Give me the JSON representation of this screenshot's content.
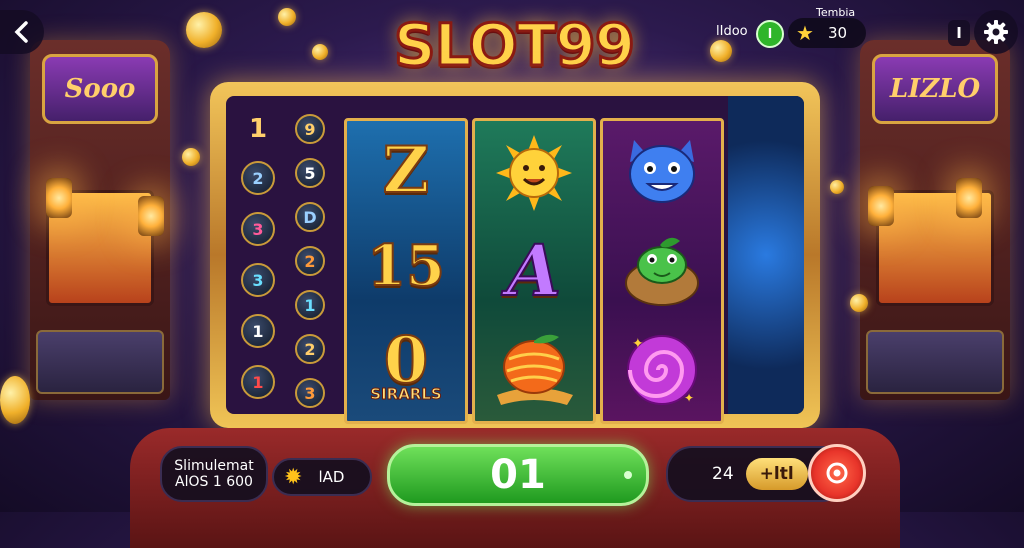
{
  "topbar": {
    "back_icon": "chevron-left-icon",
    "title": "SLOT99",
    "level_label": "lIdoo",
    "level_badge": "l",
    "stars_caption": "Tembia",
    "stars_value": "30",
    "star_icon": "star-icon",
    "info_label": "I",
    "settings_icon": "gear-icon"
  },
  "decor": {
    "left_sign": "Sooo",
    "right_sign": "LIZLO"
  },
  "machine": {
    "left_column": [
      "1",
      "2",
      "3",
      "3",
      "1",
      "1"
    ],
    "right_column": [
      "9",
      "5",
      "D",
      "2",
      "1",
      "2",
      "3"
    ],
    "reels": [
      {
        "symbols": [
          "Z",
          "15",
          "0"
        ],
        "caption": "SIRARLS"
      },
      {
        "symbols": [
          "sun-face-icon",
          "A",
          "orange-fruit-icon"
        ]
      },
      {
        "symbols": [
          "blue-cat-icon",
          "green-frog-icon",
          "purple-swirl-icon"
        ]
      }
    ]
  },
  "bottom": {
    "balance_title": "Slimulemat",
    "balance_value": "AlOS 1 600",
    "bet_icon": "sun-coin-icon",
    "bet_value": "lAD",
    "spin_label": "01",
    "lines_value": "24",
    "lines_label": "+ltl",
    "auto_icon": "auto-spin-icon"
  },
  "colors": {
    "gold": "#f2c55a",
    "spin_green": "#2fb52a",
    "auto_red": "#e8342a",
    "background": "#2c1a4e"
  }
}
